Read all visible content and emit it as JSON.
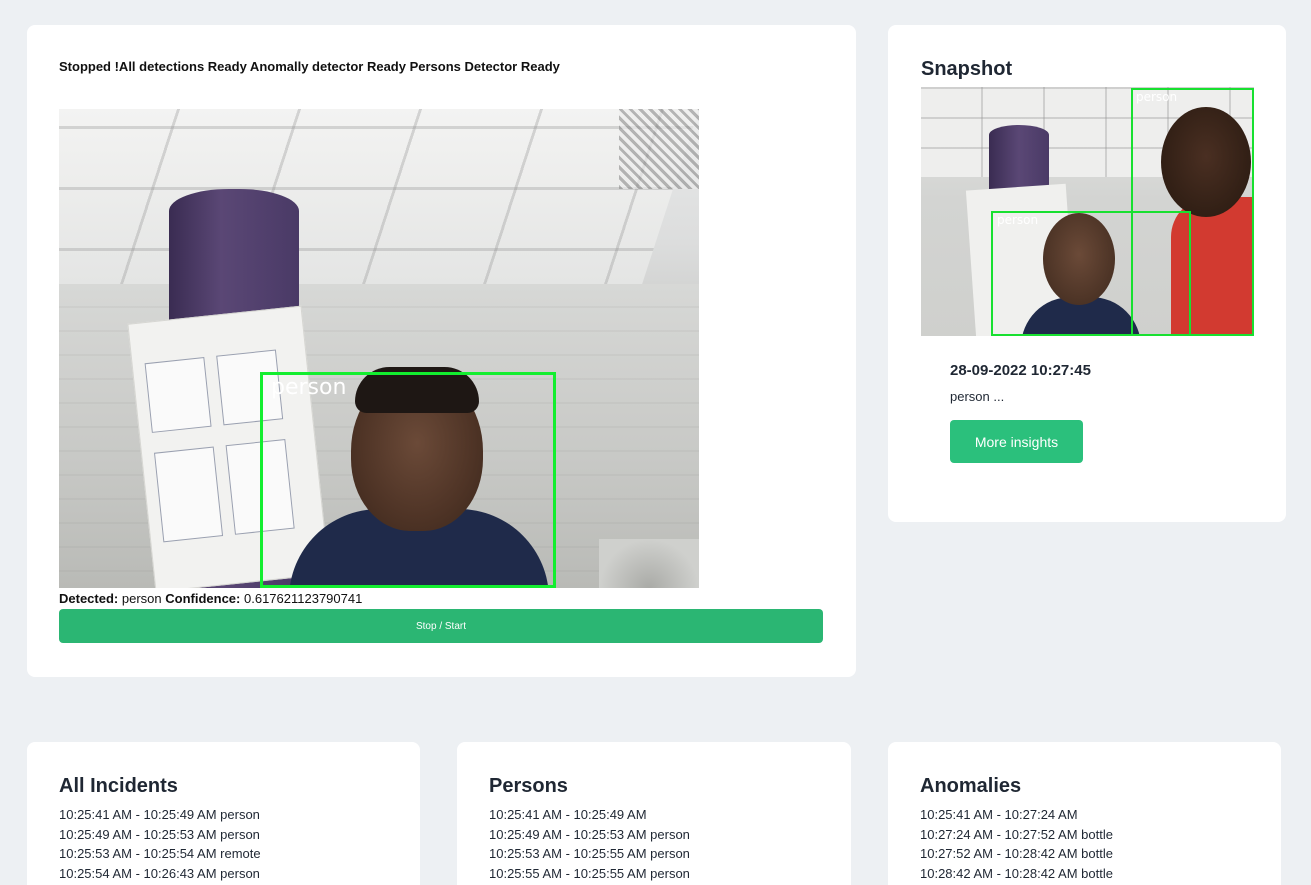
{
  "live": {
    "status_text": "Stopped !All detections Ready Anomally detector Ready Persons Detector Ready",
    "feed_detection_label": "person",
    "detected_label": "Detected:",
    "detected_value": "person",
    "confidence_label": "Confidence:",
    "confidence_value": "0.617621123790741",
    "button_label": "Stop / Start"
  },
  "snapshot": {
    "title": "Snapshot",
    "detection_labels": [
      "person",
      "person"
    ],
    "timestamp": "28-09-2022 10:27:45",
    "label": "person ...",
    "button_label": "More insights"
  },
  "incidents": {
    "title": "All Incidents",
    "items": [
      "10:25:41 AM - 10:25:49 AM person",
      "10:25:49 AM - 10:25:53 AM person",
      "10:25:53 AM - 10:25:54 AM remote",
      "10:25:54 AM - 10:26:43 AM person"
    ]
  },
  "persons": {
    "title": "Persons",
    "items": [
      "10:25:41 AM - 10:25:49 AM",
      "10:25:49 AM - 10:25:53 AM person",
      "10:25:53 AM - 10:25:55 AM person",
      "10:25:55 AM - 10:25:55 AM person"
    ]
  },
  "anomalies": {
    "title": "Anomalies",
    "items": [
      "10:25:41 AM - 10:27:24 AM",
      "10:27:24 AM - 10:27:52 AM bottle",
      "10:27:52 AM - 10:28:42 AM bottle",
      "10:28:42 AM - 10:28:42 AM bottle"
    ]
  },
  "colors": {
    "background": "#edf0f3",
    "card": "#ffffff",
    "primary_button": "#2bb673",
    "detection_box": "#13ee2f"
  }
}
